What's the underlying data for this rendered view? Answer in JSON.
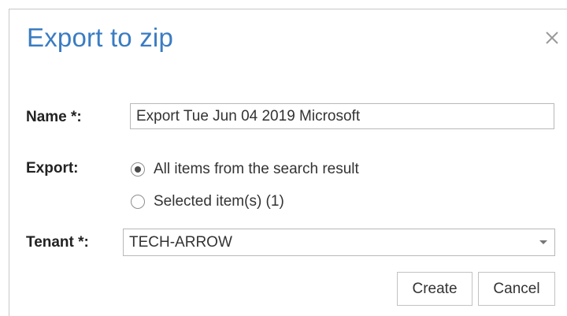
{
  "dialog": {
    "title": "Export to zip",
    "close_icon": "close-icon"
  },
  "form": {
    "name": {
      "label": "Name *:",
      "value": "Export Tue Jun 04 2019 Microsoft"
    },
    "export": {
      "label": "Export:",
      "options": [
        {
          "label": "All items from the search result",
          "selected": true
        },
        {
          "label": "Selected item(s) (1)",
          "selected": false
        }
      ]
    },
    "tenant": {
      "label": "Tenant *:",
      "selected": "TECH-ARROW"
    }
  },
  "buttons": {
    "create_label": "Create",
    "cancel_label": "Cancel"
  },
  "colors": {
    "title": "#3a7cc2",
    "border": "#b8b8b8"
  }
}
